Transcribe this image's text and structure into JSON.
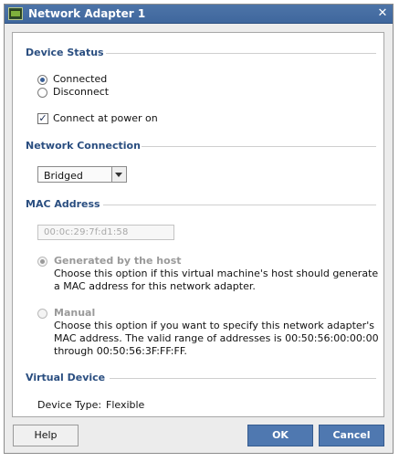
{
  "window": {
    "title": "Network Adapter 1"
  },
  "device_status": {
    "title": "Device Status",
    "connected_label": "Connected",
    "connected_selected": true,
    "disconnect_label": "Disconnect",
    "power_on_label": "Connect at power on",
    "power_on_checked": true
  },
  "network_connection": {
    "title": "Network Connection",
    "selected": "Bridged"
  },
  "mac_address": {
    "title": "MAC Address",
    "value": "00:0c:29:7f:d1:58",
    "generated_label": "Generated by the host",
    "generated_desc_1": "Choose this option if this virtual machine's host should generate",
    "generated_desc_2": "a MAC address for this network adapter.",
    "manual_label": "Manual",
    "manual_desc_1": "Choose this option if you want to specify this network adapter's",
    "manual_desc_2": "MAC address. The valid range of addresses is 00:50:56:00:00:00",
    "manual_desc_3": "through 00:50:56:3F:FF:FF."
  },
  "virtual_device": {
    "title": "Virtual Device",
    "device_type_label": "Device Type:",
    "device_type_value": "Flexible"
  },
  "buttons": {
    "help": "Help",
    "ok": "OK",
    "cancel": "Cancel"
  },
  "colors": {
    "title_bar": "#4d74a8",
    "section_title": "#2a4e80",
    "primary_button": "#4f78b0"
  }
}
